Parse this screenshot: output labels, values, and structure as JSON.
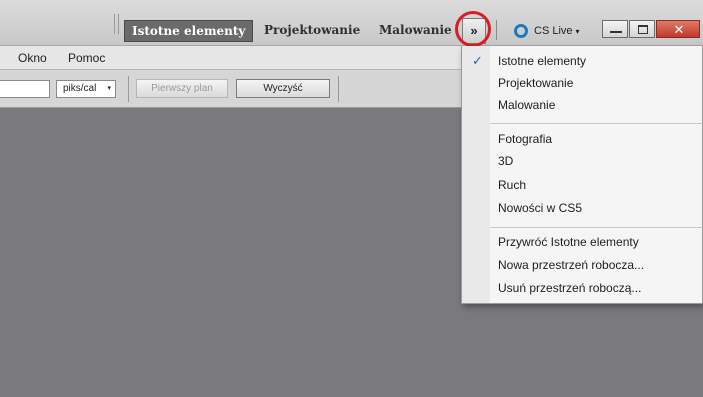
{
  "workspace_bar": {
    "buttons": [
      "Istotne elementy",
      "Projektowanie",
      "Malowanie"
    ],
    "more_symbol": "»",
    "cs_live": "CS Live",
    "caret": "▾",
    "close_symbol": "✕"
  },
  "menubar": {
    "items": [
      "Okno",
      "Pomoc"
    ]
  },
  "options_bar": {
    "number_value": "",
    "unit_selected": "piks/cal",
    "unit_caret": "▾",
    "front_button": "Pierwszy plan",
    "clear_button": "Wyczyść"
  },
  "dropdown": {
    "checkmark": "✓",
    "items": [
      "Istotne elementy",
      "Projektowanie",
      "Malowanie",
      "Fotografia",
      "3D",
      "Ruch",
      "Nowości w CS5",
      "Przywróć Istotne elementy",
      "Nowa przestrzeń robocza...",
      "Usuń przestrzeń roboczą..."
    ]
  },
  "colors": {
    "workspace": "#7a7a7e",
    "active_tab": "#6a6a6a",
    "highlight_circle": "#d81e24",
    "cs_live_ring": "#1c7bc0",
    "close_button": "#c0392b"
  }
}
